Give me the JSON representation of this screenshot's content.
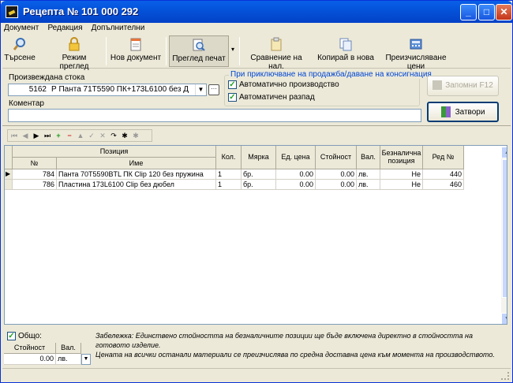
{
  "title": "Рецепта № 101 000 292",
  "menu": [
    "Документ",
    "Редакция",
    "Допълнителни"
  ],
  "toolbar": {
    "search": "Търсене",
    "view_mode": "Режим преглед",
    "new_document": "Нов документ",
    "print_preview": "Преглед печат",
    "compare": "Сравнение на нал.",
    "copy_new": "Копирай в нова",
    "recalc": "Преизчисляване цени"
  },
  "form": {
    "produced_label": "Произвеждана стока",
    "produced_code": "5162",
    "produced_name": "Р Панта 71T5590 ПК+173L6100 без Д",
    "comment_label": "Коментар",
    "comment_value": "",
    "group_title": "При приключване на продажба/даване на консигнация",
    "auto_production": "Автоматично производство",
    "auto_consumption": "Автоматичен разпад",
    "save_button": "Запомни  F12",
    "close_button": "Затвори"
  },
  "grid": {
    "header_position": "Позиция",
    "columns": {
      "no": "№",
      "name": "Име",
      "qty": "Кол.",
      "unit": "Мярка",
      "unit_price": "Ед. цена",
      "value": "Стойност",
      "currency": "Вал.",
      "cashless": "Безналична позиция",
      "row_no": "Ред №"
    },
    "rows": [
      {
        "no": "784",
        "name": "Панта 70T5590BTL ПК Clip 120 без пружина",
        "qty": "1",
        "unit": "бр.",
        "unit_price": "0.00",
        "value": "0.00",
        "currency": "лв.",
        "cashless": "Не",
        "row_no": "440"
      },
      {
        "no": "786",
        "name": "Пластина 173L6100 Clip без дюбел",
        "qty": "1",
        "unit": "бр.",
        "unit_price": "0.00",
        "value": "0.00",
        "currency": "лв.",
        "cashless": "Не",
        "row_no": "460"
      }
    ]
  },
  "totals": {
    "total_label": "Общо:",
    "value_header": "Стойност",
    "currency_header": "Вал.",
    "value": "0.00",
    "currency": "лв."
  },
  "note": {
    "line1": "Забележка: Единствено стойността на безналичните позиции ще бъде включена директно в стойността на готовото изделие.",
    "line2": "Цената на всички останали материали се преизчислява по средна доставна цена към момента на производството."
  }
}
